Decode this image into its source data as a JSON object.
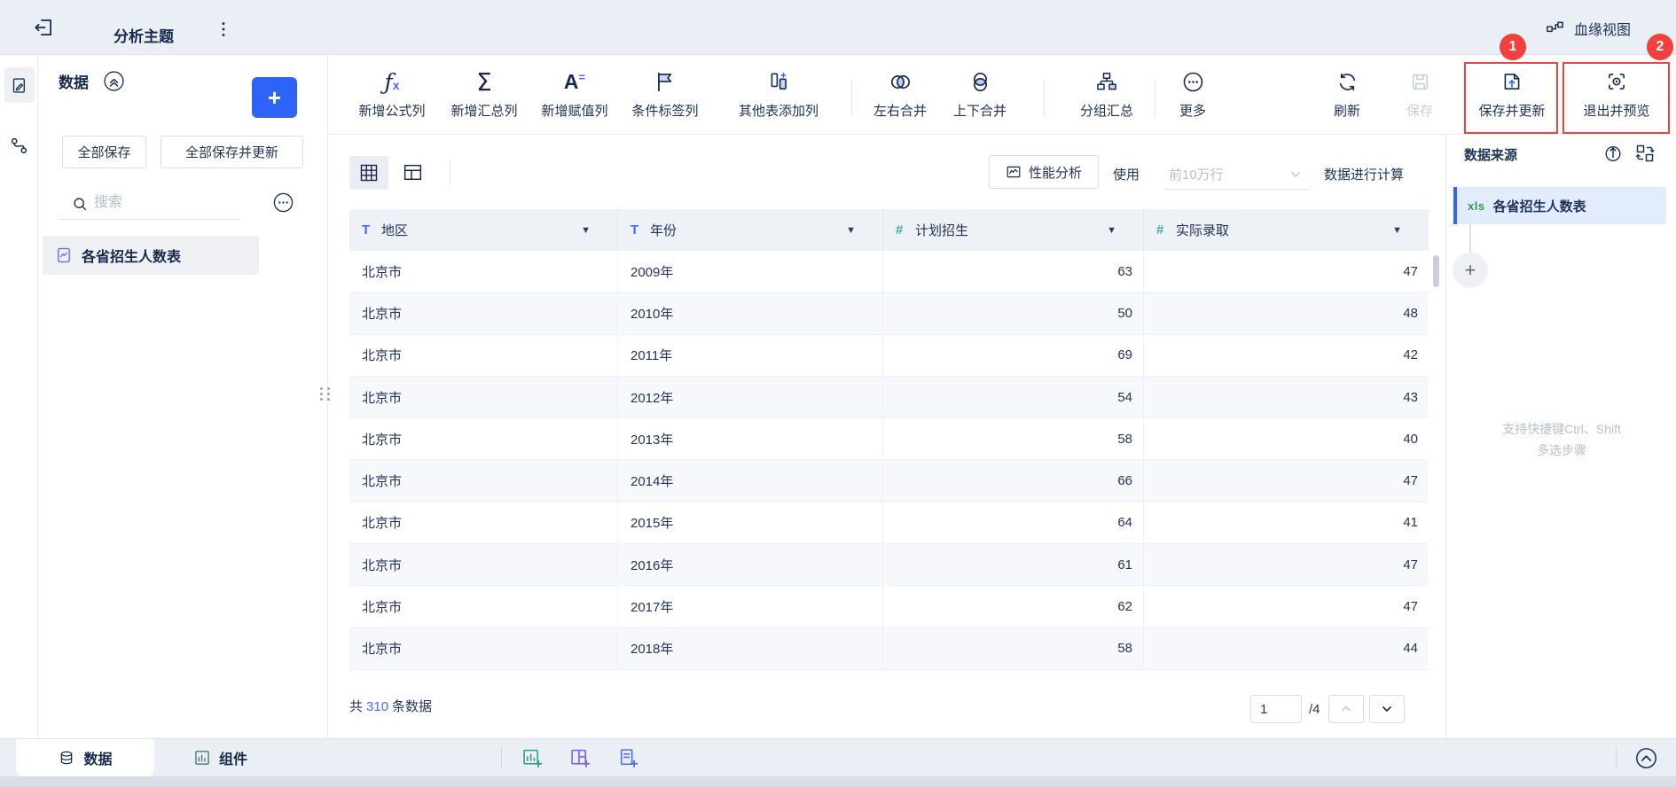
{
  "topbar": {
    "title": "分析主题",
    "lineage": "血缘视图"
  },
  "badges": [
    "1",
    "2"
  ],
  "sidebar": {
    "panel_title": "数据",
    "save_all": "全部保存",
    "save_all_update": "全部保存并更新",
    "search_placeholder": "搜索",
    "table_item": "各省招生人数表"
  },
  "toolbar": {
    "items": [
      "新增公式列",
      "新增汇总列",
      "新增赋值列",
      "条件标签列",
      "其他表添加列",
      "左右合并",
      "上下合并",
      "分组汇总",
      "更多",
      "刷新",
      "保存",
      "保存并更新",
      "退出并预览"
    ]
  },
  "view_controls": {
    "perf_label": "性能分析",
    "use_label": "使用",
    "row_limit": "前10万行",
    "compute_label": "数据进行计算"
  },
  "table": {
    "columns": [
      {
        "type": "text",
        "label": "地区"
      },
      {
        "type": "text",
        "label": "年份"
      },
      {
        "type": "number",
        "label": "计划招生"
      },
      {
        "type": "number",
        "label": "实际录取"
      }
    ],
    "rows": [
      [
        "北京市",
        "2009年",
        "63",
        "47"
      ],
      [
        "北京市",
        "2010年",
        "50",
        "48"
      ],
      [
        "北京市",
        "2011年",
        "69",
        "42"
      ],
      [
        "北京市",
        "2012年",
        "54",
        "43"
      ],
      [
        "北京市",
        "2013年",
        "58",
        "40"
      ],
      [
        "北京市",
        "2014年",
        "66",
        "47"
      ],
      [
        "北京市",
        "2015年",
        "64",
        "41"
      ],
      [
        "北京市",
        "2016年",
        "61",
        "47"
      ],
      [
        "北京市",
        "2017年",
        "62",
        "47"
      ],
      [
        "北京市",
        "2018年",
        "58",
        "44"
      ]
    ]
  },
  "footer": {
    "total_prefix": "共",
    "total_count": "310",
    "total_suffix": "条数据",
    "page_value": "1",
    "page_total": "/4"
  },
  "right_panel": {
    "title": "数据来源",
    "source_type": "xls",
    "source_name": "各省招生人数表",
    "hint_line1": "支持快捷键Ctrl、Shift",
    "hint_line2": "多选步骤"
  },
  "bottom_bar": {
    "tab_data": "数据",
    "tab_component": "组件"
  },
  "colors": {
    "accent_blue": "#2d63f6",
    "badge_red": "#f2413c",
    "teal": "#35b0a5",
    "indigo": "#4a69f7",
    "xls_green": "#2c9e4b"
  }
}
